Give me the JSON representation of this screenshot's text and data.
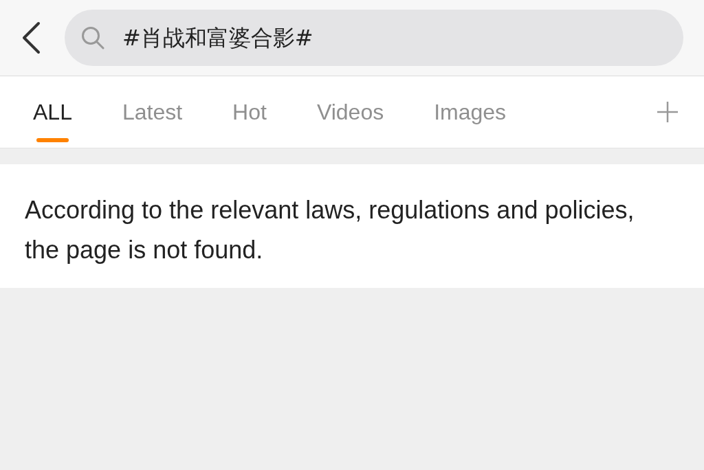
{
  "search": {
    "value": "#肖战和富婆合影#"
  },
  "tabs": [
    {
      "label": "ALL",
      "selected": true
    },
    {
      "label": "Latest",
      "selected": false
    },
    {
      "label": "Hot",
      "selected": false
    },
    {
      "label": "Videos",
      "selected": false
    },
    {
      "label": "Images",
      "selected": false
    }
  ],
  "message": "According to the relevant laws, regulations and policies, the page is not found."
}
